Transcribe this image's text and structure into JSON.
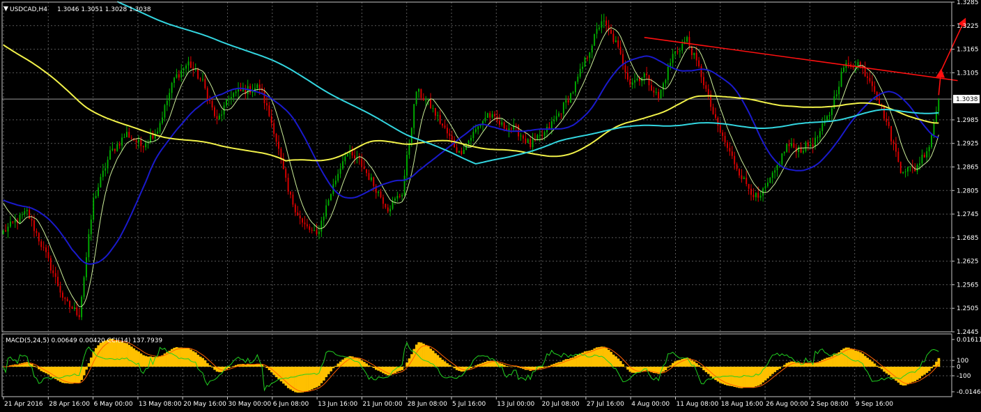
{
  "main_header": {
    "symbol_label": "USDCAD,H4",
    "ohlc_label": "1.3046 1.3051 1.3028 1.3038"
  },
  "sub_header": {
    "label": "MACD(5,24,5) 0.00649 0.00420  CCI(14) 137.7939"
  },
  "colors": {
    "background": "#000000",
    "grid": "#5a5a5a",
    "frame": "#c8c8c8",
    "bull_candle": "#00b000",
    "bear_candle": "#e00000",
    "ma_fast": "#ccee99",
    "ma_medium": "#1a1acc",
    "ma_slow": "#f2f24a",
    "ma_long": "#33d6e0",
    "trendline": "#ff1010",
    "macd_hist": "#ffc000",
    "macd_signal": "#ff6000",
    "cci_line": "#20d020",
    "price_tag_bg": "#ffffff"
  },
  "chart_data": [
    {
      "type": "candlestick",
      "name": "USDCAD,H4",
      "y_ticks": [
        "1.3285",
        "1.3225",
        "1.3165",
        "1.3105",
        "1.2985",
        "1.2925",
        "1.2865",
        "1.2805",
        "1.2745",
        "1.2685",
        "1.2625",
        "1.2565",
        "1.2505",
        "1.2445"
      ],
      "ylim": [
        1.2445,
        1.3285
      ],
      "current_price": "1.3038",
      "x_ticks": [
        "21 Apr 2016",
        "28 Apr 16:00",
        "6 May 00:00",
        "13 May 08:00",
        "20 May 16:00",
        "30 May 00:00",
        "6 Jun 08:00",
        "13 Jun 16:00",
        "21 Jun 00:00",
        "28 Jun 08:00",
        "5 Jul 16:00",
        "13 Jul 00:00",
        "20 Jul 08:00",
        "27 Jul 16:00",
        "4 Aug 00:00",
        "11 Aug 08:00",
        "18 Aug 16:00",
        "26 Aug 00:00",
        "2 Sep 08:00",
        "9 Sep 16:00"
      ],
      "close_anchors": [
        [
          0,
          1.27
        ],
        [
          10,
          1.275
        ],
        [
          18,
          1.264
        ],
        [
          26,
          1.252
        ],
        [
          32,
          1.249
        ],
        [
          38,
          1.278
        ],
        [
          45,
          1.29
        ],
        [
          52,
          1.295
        ],
        [
          58,
          1.292
        ],
        [
          65,
          1.296
        ],
        [
          72,
          1.309
        ],
        [
          78,
          1.313
        ],
        [
          84,
          1.308
        ],
        [
          90,
          1.298
        ],
        [
          96,
          1.305
        ],
        [
          102,
          1.306
        ],
        [
          108,
          1.307
        ],
        [
          114,
          1.296
        ],
        [
          120,
          1.28
        ],
        [
          126,
          1.272
        ],
        [
          132,
          1.269
        ],
        [
          138,
          1.28
        ],
        [
          144,
          1.29
        ],
        [
          150,
          1.288
        ],
        [
          156,
          1.282
        ],
        [
          162,
          1.276
        ],
        [
          168,
          1.28
        ],
        [
          174,
          1.306
        ],
        [
          180,
          1.302
        ],
        [
          186,
          1.296
        ],
        [
          192,
          1.29
        ],
        [
          198,
          1.295
        ],
        [
          204,
          1.3
        ],
        [
          210,
          1.297
        ],
        [
          216,
          1.296
        ],
        [
          222,
          1.292
        ],
        [
          228,
          1.295
        ],
        [
          234,
          1.3
        ],
        [
          240,
          1.306
        ],
        [
          246,
          1.315
        ],
        [
          252,
          1.324
        ],
        [
          258,
          1.318
        ],
        [
          264,
          1.308
        ],
        [
          270,
          1.31
        ],
        [
          276,
          1.304
        ],
        [
          282,
          1.315
        ],
        [
          288,
          1.319
        ],
        [
          294,
          1.31
        ],
        [
          300,
          1.298
        ],
        [
          306,
          1.29
        ],
        [
          312,
          1.283
        ],
        [
          318,
          1.278
        ],
        [
          324,
          1.284
        ],
        [
          330,
          1.292
        ],
        [
          336,
          1.291
        ],
        [
          342,
          1.293
        ],
        [
          348,
          1.3
        ],
        [
          354,
          1.312
        ],
        [
          360,
          1.313
        ],
        [
          366,
          1.308
        ],
        [
          372,
          1.298
        ],
        [
          378,
          1.286
        ],
        [
          384,
          1.286
        ],
        [
          390,
          1.292
        ],
        [
          394,
          1.3038
        ]
      ],
      "moving_averages": [
        {
          "role": "ma_fast",
          "period": 8
        },
        {
          "role": "ma_medium",
          "period": 30
        },
        {
          "role": "ma_slow",
          "period": 120
        },
        {
          "role": "ma_long",
          "period": 200
        }
      ],
      "annotations": [
        {
          "type": "trendline",
          "from": [
            270,
            1.3195
          ],
          "to": [
            402,
            1.3085
          ]
        },
        {
          "type": "arrow",
          "from": [
            394,
            1.3048
          ],
          "to": [
            395,
            1.311
          ]
        },
        {
          "type": "arrow",
          "from": [
            395,
            1.311
          ],
          "to": [
            405,
            1.324
          ]
        }
      ]
    },
    {
      "type": "oscillator",
      "name": "MACD(5,24,5) / CCI(14)",
      "y_ticks": [
        "0.01611",
        "100",
        "0",
        "-100",
        "-0.01461"
      ],
      "ylim": [
        -0.01461,
        0.01611
      ],
      "series": [
        {
          "role": "macd_hist",
          "value": "0.00649"
        },
        {
          "role": "macd_signal",
          "value": "0.00420"
        },
        {
          "role": "cci_line",
          "value": "137.7939"
        }
      ]
    }
  ]
}
